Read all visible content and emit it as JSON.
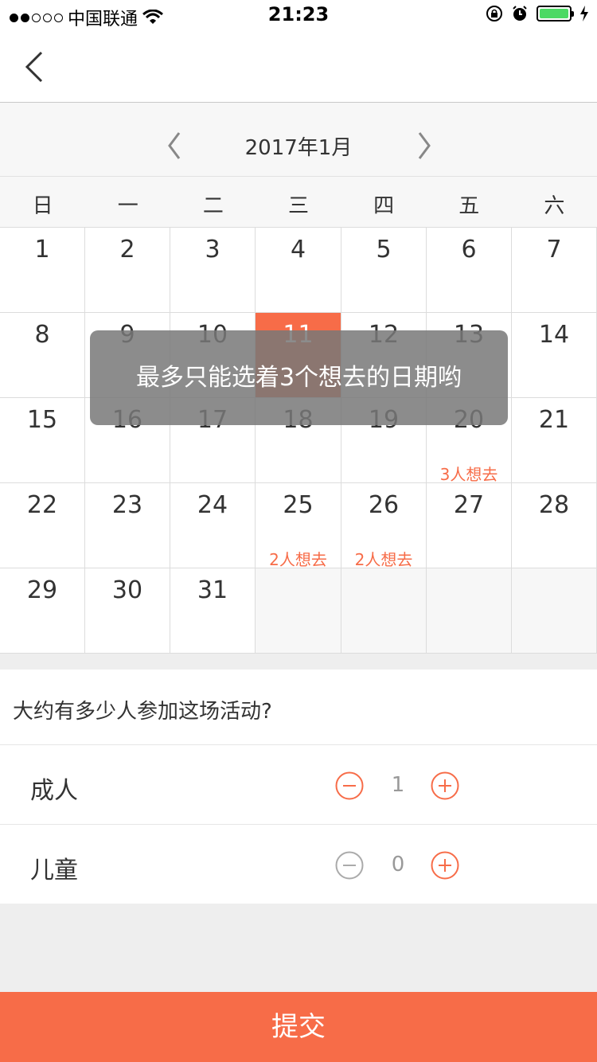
{
  "status_bar": {
    "carrier": "中国联通",
    "time": "21:23"
  },
  "calendar": {
    "month_title": "2017年1月",
    "weekdays": [
      "日",
      "一",
      "二",
      "三",
      "四",
      "五",
      "六"
    ],
    "weeks": [
      [
        {
          "day": "1"
        },
        {
          "day": "2"
        },
        {
          "day": "3"
        },
        {
          "day": "4"
        },
        {
          "day": "5"
        },
        {
          "day": "6"
        },
        {
          "day": "7"
        }
      ],
      [
        {
          "day": "8"
        },
        {
          "day": "9"
        },
        {
          "day": "10"
        },
        {
          "day": "11",
          "selected": true
        },
        {
          "day": "12"
        },
        {
          "day": "13"
        },
        {
          "day": "14"
        }
      ],
      [
        {
          "day": "15"
        },
        {
          "day": "16"
        },
        {
          "day": "17"
        },
        {
          "day": "18"
        },
        {
          "day": "19"
        },
        {
          "day": "20",
          "note": "3人想去"
        },
        {
          "day": "21"
        }
      ],
      [
        {
          "day": "22"
        },
        {
          "day": "23"
        },
        {
          "day": "24"
        },
        {
          "day": "25",
          "note": "2人想去"
        },
        {
          "day": "26",
          "note": "2人想去"
        },
        {
          "day": "27"
        },
        {
          "day": "28"
        }
      ],
      [
        {
          "day": "29"
        },
        {
          "day": "30"
        },
        {
          "day": "31"
        },
        {
          "day": ""
        },
        {
          "day": ""
        },
        {
          "day": ""
        },
        {
          "day": ""
        }
      ]
    ],
    "accent_color": "#f76c48"
  },
  "toast": {
    "message": "最多只能选着3个想去的日期哟"
  },
  "participants": {
    "question": "大约有多少人参加这场活动?",
    "rows": [
      {
        "label": "成人",
        "count": "1"
      },
      {
        "label": "儿童",
        "count": "0"
      }
    ]
  },
  "submit_label": "提交"
}
